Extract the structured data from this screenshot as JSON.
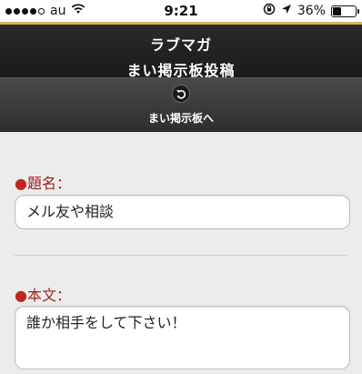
{
  "status_bar": {
    "carrier": "au",
    "time": "9:21",
    "battery_percent": "36%",
    "battery_level": 0.36,
    "icons": [
      "signal-dots-icon",
      "wifi-icon",
      "rotation-lock-icon",
      "location-arrow-icon",
      "battery-icon"
    ]
  },
  "header": {
    "app_title": "ラブマガ",
    "page_title": "まい掲示板投稿",
    "accent_color": "#d9b25c"
  },
  "nav": {
    "back_icon": "reload-back-icon",
    "back_label": "まい掲示板へ"
  },
  "form": {
    "subject": {
      "bullet": "●",
      "label": "題名：",
      "value": "メル友や相談"
    },
    "body": {
      "bullet": "●",
      "label": "本文：",
      "value": "誰か相手をして下さい！"
    },
    "label_color": "#a0221b"
  }
}
